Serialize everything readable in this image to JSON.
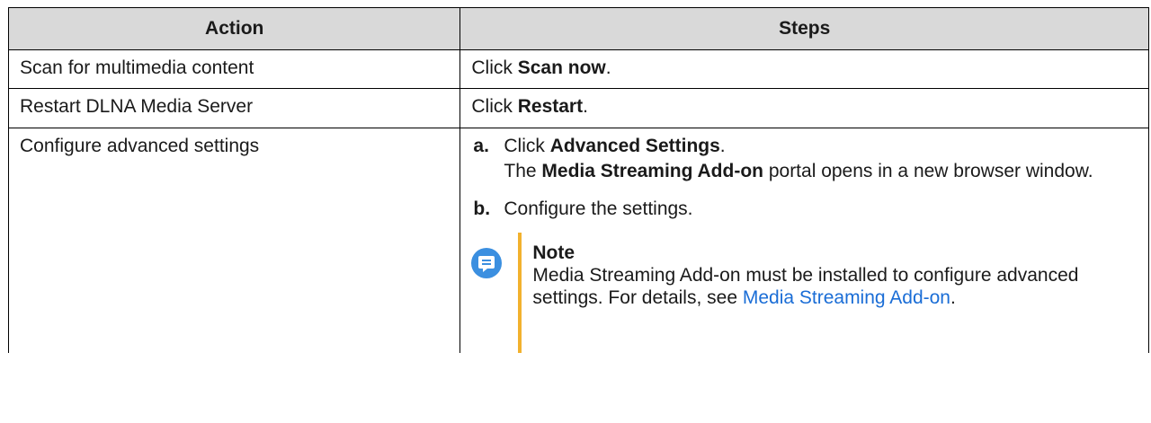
{
  "table": {
    "headers": [
      "Action",
      "Steps"
    ],
    "rows": [
      {
        "action": "Scan for multimedia content",
        "step_prefix": "Click ",
        "step_bold": "Scan now",
        "step_suffix": "."
      },
      {
        "action": "Restart DLNA Media Server",
        "step_prefix": "Click ",
        "step_bold": "Restart",
        "step_suffix": "."
      },
      {
        "action": "Configure advanced settings",
        "substeps": [
          {
            "letter": "a.",
            "line1_prefix": "Click ",
            "line1_bold": "Advanced Settings",
            "line1_suffix": ".",
            "line2_prefix": "The ",
            "line2_bold": "Media Streaming Add-on",
            "line2_suffix": " portal opens in a new browser window."
          },
          {
            "letter": "b.",
            "text": "Configure the settings."
          }
        ],
        "note": {
          "icon": "note-icon",
          "title": "Note",
          "text": "Media Streaming Add-on must be installed to configure advanced settings. For details, see ",
          "link": "Media Streaming Add-on",
          "suffix": "."
        }
      }
    ]
  },
  "colors": {
    "header_bg": "#d9d9d9",
    "note_icon": "#3b8fe0",
    "note_bar": "#f2b12e",
    "link": "#1a6dd6"
  }
}
